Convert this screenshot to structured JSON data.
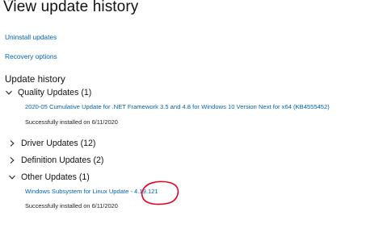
{
  "page": {
    "title": "View update history"
  },
  "links": {
    "uninstall": "Uninstall updates",
    "recovery": "Recovery options"
  },
  "history": {
    "heading": "Update history",
    "groups": [
      {
        "label": "Quality Updates (1)",
        "expanded": true,
        "items": [
          {
            "name": "2020-05 Cumulative Update for .NET Framework 3.5 and 4.8 for Windows 10 Version Next for x64 (KB4555452)",
            "status": "Successfully installed on 6/11/2020"
          }
        ]
      },
      {
        "label": "Driver Updates (12)",
        "expanded": false
      },
      {
        "label": "Definition Updates (2)",
        "expanded": false
      },
      {
        "label": "Other Updates (1)",
        "expanded": true,
        "items": [
          {
            "name": "Windows Subsystem for Linux Update - 4.19.121",
            "status": "Successfully installed on 6/11/2020"
          }
        ]
      }
    ]
  },
  "colors": {
    "link": "#0063b1",
    "annotation": "#e8001c"
  },
  "icons": {
    "expanded": "chevron-down-icon",
    "collapsed": "chevron-right-icon"
  }
}
